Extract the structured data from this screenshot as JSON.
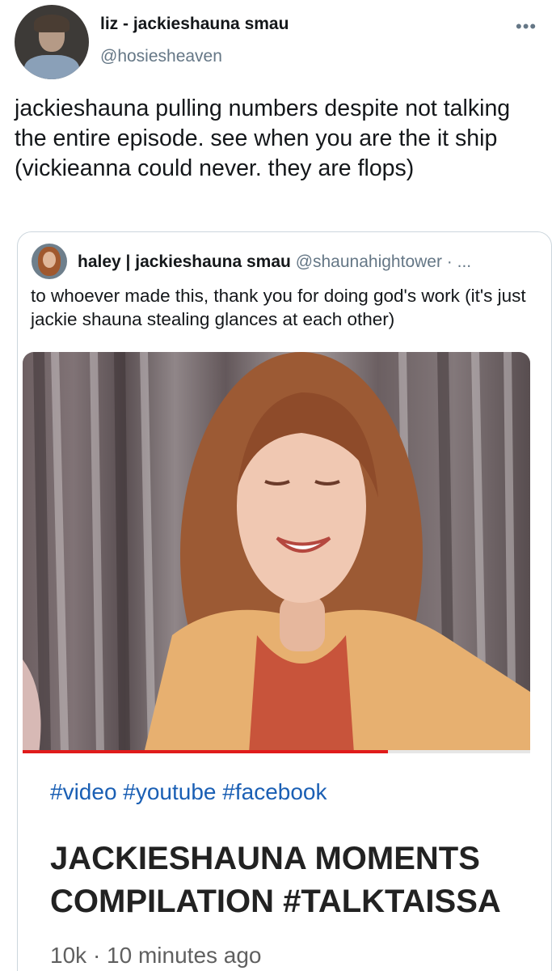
{
  "tweet": {
    "display_name": "liz - jackieshauna smau",
    "handle": "@hosiesheaven",
    "more_icon": "more-dots-icon",
    "text": "jackieshauna pulling numbers despite not talking the entire episode. see when you are the it ship (vickieanna could never. they are flops)"
  },
  "quoted": {
    "display_name": "haley | jackieshauna smau",
    "handle_suffix": "@shaunahightower · ...",
    "text": "to whoever made this, thank you for doing god's work (it's just jackie shauna stealing glances at each other)",
    "video": {
      "progress_fraction": 0.72,
      "hashtags": "#video #youtube #facebook",
      "title_line1": "JACKIESHAUNA MOMENTS",
      "title_line2": "COMPILATION #TALKTAISSA",
      "views": "10k",
      "separator": "·",
      "posted": "10 minutes ago"
    }
  },
  "colors": {
    "link_blue": "#1a5fb4",
    "progress_red": "#e01b1b",
    "secondary_text": "#657786"
  }
}
